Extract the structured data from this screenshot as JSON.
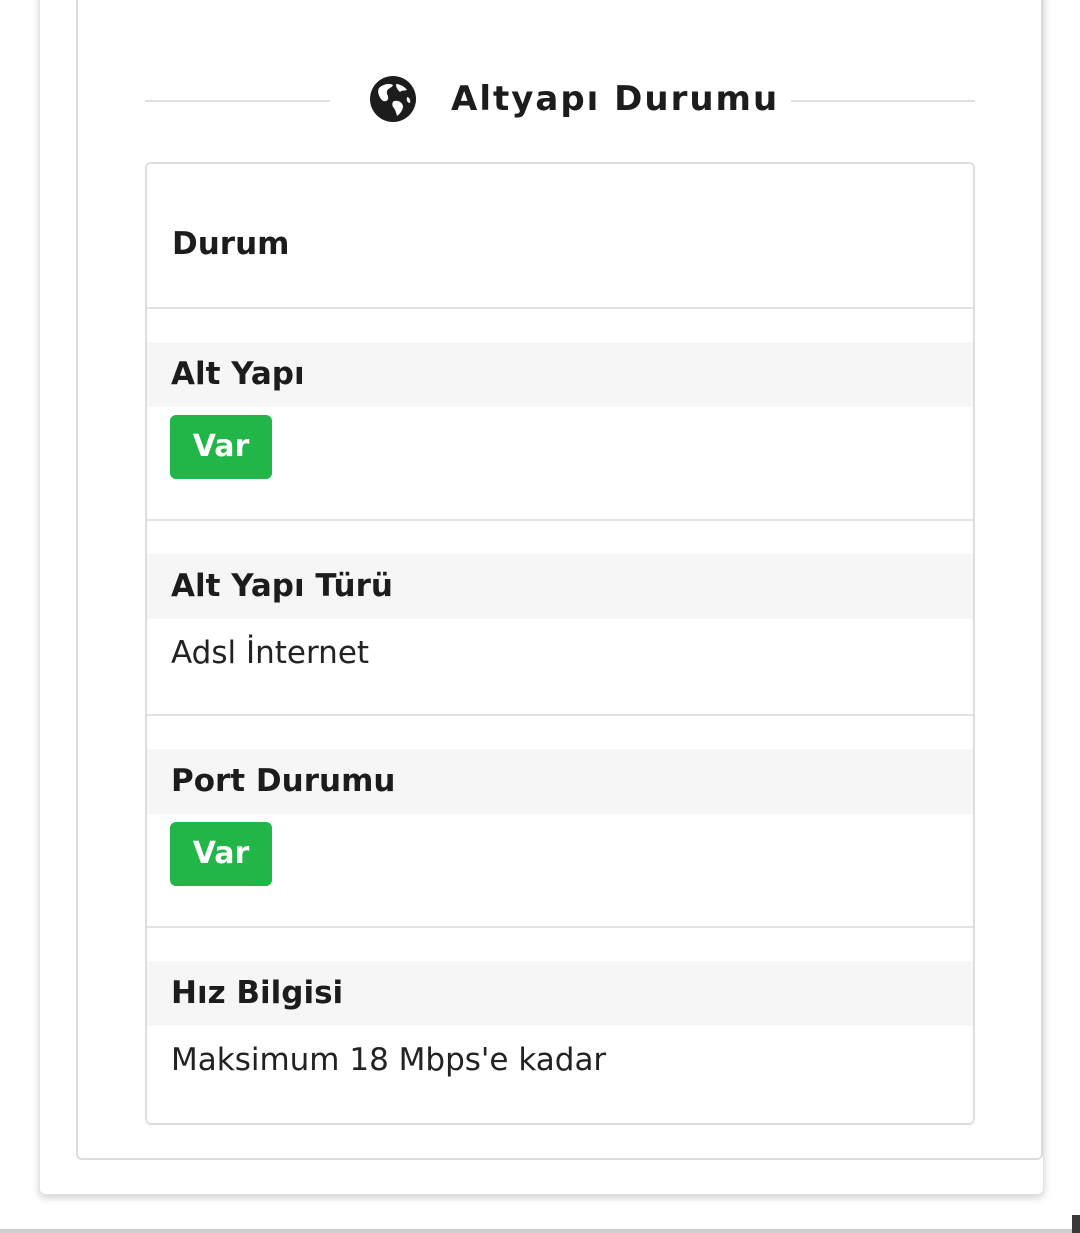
{
  "section": {
    "title": "Altyapı Durumu",
    "icon": "globe-icon"
  },
  "table": {
    "header": "Durum",
    "rows": [
      {
        "label": "Alt Yapı",
        "badge": "Var"
      },
      {
        "label": "Alt Yapı Türü",
        "value": "Adsl İnternet"
      },
      {
        "label": "Port Durumu",
        "badge": "Var"
      },
      {
        "label": "Hız Bilgisi",
        "value": "Maksimum 18 Mbps'e kadar"
      }
    ]
  },
  "colors": {
    "badge_green": "#22b548",
    "label_background": "#f6f6f6",
    "text": "#1c1c1c"
  }
}
